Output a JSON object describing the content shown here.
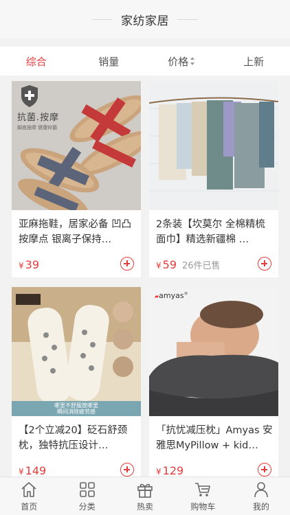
{
  "header": {
    "title": "家纺家居"
  },
  "tabs": [
    {
      "label": "综合",
      "active": true
    },
    {
      "label": "销量",
      "active": false
    },
    {
      "label": "价格",
      "active": false
    },
    {
      "label": "上新",
      "active": false
    }
  ],
  "products": [
    {
      "name": "亚麻拖鞋，居家必备 凹凸按摩点 银离子保持…",
      "price_symbol": "¥",
      "price": "39",
      "sold": "",
      "badge_title": "抗菌.按摩",
      "badge_sub": "脚底按摩 健康抑菌"
    },
    {
      "name": "2条装【坎莫尔 全棉精梳面巾】精选新疆棉 …",
      "price_symbol": "¥",
      "price": "59",
      "sold": "26件已售"
    },
    {
      "name": "【2个立减20】砭石舒颈枕，独特抗压设计…",
      "price_symbol": "¥",
      "price": "149",
      "sold": "",
      "img_caption_1": "哪里不舒服放哪里",
      "img_caption_2": "瞬间消除疲劳感"
    },
    {
      "name": "「抗忧减压枕」Amyas 安雅思MyPillow + kid…",
      "price_symbol": "¥",
      "price": "129",
      "sold": "",
      "brand": "amyas"
    }
  ],
  "bottom_nav": [
    {
      "label": "首页",
      "icon": "home-icon"
    },
    {
      "label": "分类",
      "icon": "grid-icon"
    },
    {
      "label": "热卖",
      "icon": "gift-icon"
    },
    {
      "label": "购物车",
      "icon": "cart-icon"
    },
    {
      "label": "我的",
      "icon": "user-icon"
    }
  ],
  "colors": {
    "accent": "#e63b3b",
    "background": "#f2f2f2"
  }
}
